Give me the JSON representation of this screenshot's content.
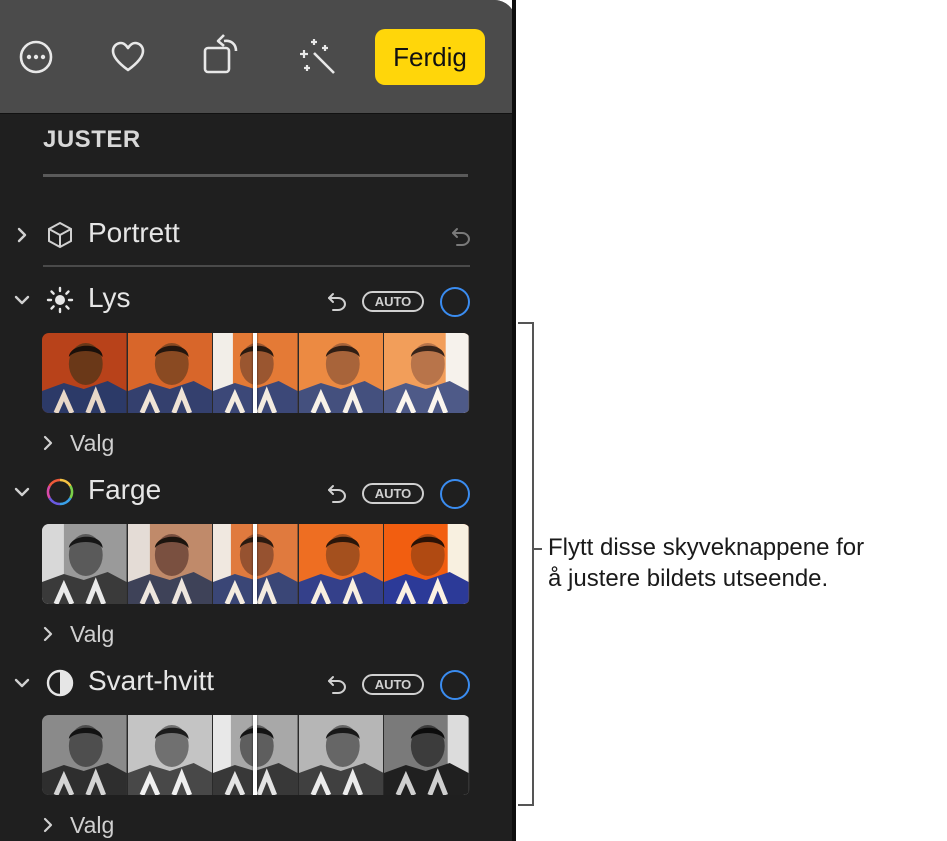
{
  "toolbar": {
    "icons": [
      "more-icon",
      "heart-icon",
      "rotate-icon",
      "magic-wand-icon"
    ],
    "done_label": "Ferdig",
    "done_color": "#ffd60a"
  },
  "panel": {
    "section_title": "JUSTER",
    "portrait": {
      "label": "Portrett"
    },
    "sections": [
      {
        "label": "Lys",
        "auto_label": "AUTO",
        "options_label": "Valg",
        "icon": "sun-icon",
        "strip_style": "warm"
      },
      {
        "label": "Farge",
        "auto_label": "AUTO",
        "options_label": "Valg",
        "icon": "color-wheel-icon",
        "strip_style": "color"
      },
      {
        "label": "Svart-hvitt",
        "auto_label": "AUTO",
        "options_label": "Valg",
        "icon": "half-circle-icon",
        "strip_style": "mono"
      }
    ]
  },
  "callout": {
    "line1": "Flytt disse skyveknappene for",
    "line2": "å justere bildets utseende."
  },
  "colors": {
    "accent_ring": "#3a8cf0",
    "panel_bg": "#1f1f1f",
    "toolbar_bg": "#4b4b4b"
  }
}
